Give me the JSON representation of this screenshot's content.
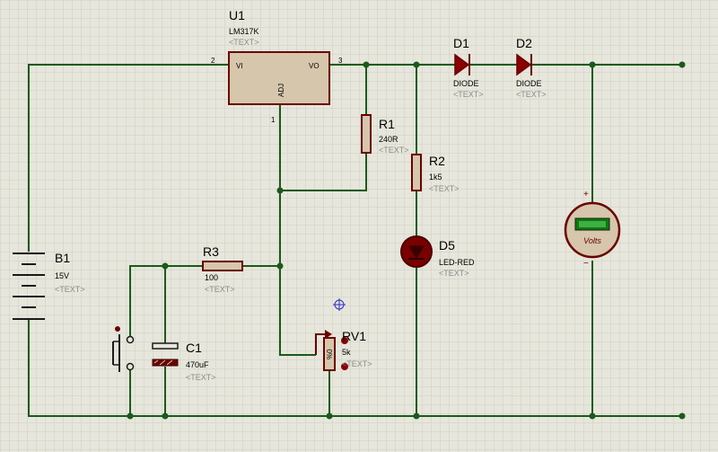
{
  "components": {
    "u1": {
      "ref": "U1",
      "value": "LM317K",
      "text": "<TEXT>",
      "pin_vi": "VI",
      "pin_vo": "VO",
      "pin_adj": "ADJ",
      "pin1": "1",
      "pin2": "2",
      "pin3": "3"
    },
    "d1": {
      "ref": "D1",
      "value": "DIODE",
      "text": "<TEXT>"
    },
    "d2": {
      "ref": "D2",
      "value": "DIODE",
      "text": "<TEXT>"
    },
    "r1": {
      "ref": "R1",
      "value": "240R",
      "text": "<TEXT>"
    },
    "r2": {
      "ref": "R2",
      "value": "1k5",
      "text": "<TEXT>"
    },
    "r3": {
      "ref": "R3",
      "value": "100",
      "text": "<TEXT>"
    },
    "d5": {
      "ref": "D5",
      "value": "LED-RED",
      "text": "<TEXT>"
    },
    "b1": {
      "ref": "B1",
      "value": "15V",
      "text": "<TEXT>"
    },
    "c1": {
      "ref": "C1",
      "value": "470uF",
      "text": "<TEXT>"
    },
    "rv1": {
      "ref": "RV1",
      "value": "5k",
      "text": "<TEXT>",
      "wiper": "%0"
    },
    "voltmeter": {
      "unit": "Volts",
      "plus": "+",
      "minus": "−"
    }
  },
  "colors": {
    "grid": "#cfcfc0",
    "background": "#e6e6dc",
    "wire": "#1a5a1a",
    "component_outline": "#6b0000",
    "component_fill": "#d6c6ac",
    "meter_display": "#0d7a0d"
  }
}
